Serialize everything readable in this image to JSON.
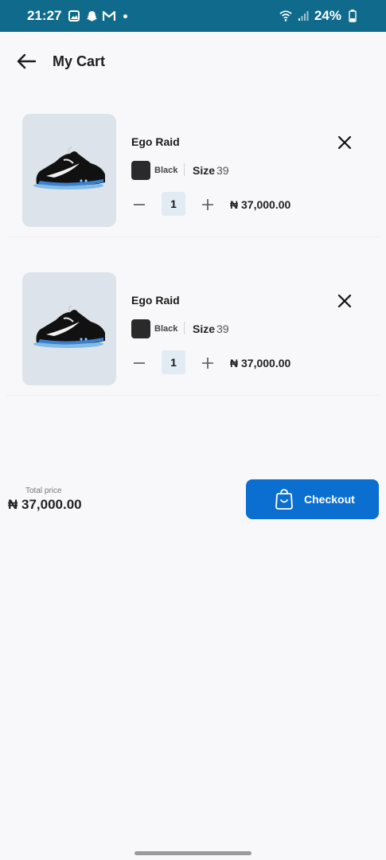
{
  "status_bar": {
    "time": "21:27",
    "battery": "24%",
    "icons": [
      "gallery-icon",
      "snapchat-icon",
      "gmail-icon",
      "dot-icon",
      "wifi-icon",
      "signal-icon",
      "battery-icon"
    ]
  },
  "header": {
    "title": "My Cart",
    "back_icon": "back-arrow-icon"
  },
  "cart": {
    "items": [
      {
        "name": "Ego Raid",
        "color": "Black",
        "color_hex": "#2a2a2a",
        "size_label": "Size",
        "size": "39",
        "quantity": "1",
        "price": "₦ 37,000.00"
      },
      {
        "name": "Ego Raid",
        "color": "Black",
        "color_hex": "#2a2a2a",
        "size_label": "Size",
        "size": "39",
        "quantity": "1",
        "price": "₦ 37,000.00"
      }
    ]
  },
  "summary": {
    "total_label": "Total price",
    "total_value": "₦ 37,000.00"
  },
  "checkout": {
    "label": "Checkout",
    "icon": "shopping-bag-icon",
    "color": "#0a6fd0"
  },
  "colors": {
    "status_bar": "#0f6a8b",
    "background": "#f8f8fa",
    "thumb_bg": "#dde3ea",
    "qty_bg": "#e1ebf4"
  }
}
